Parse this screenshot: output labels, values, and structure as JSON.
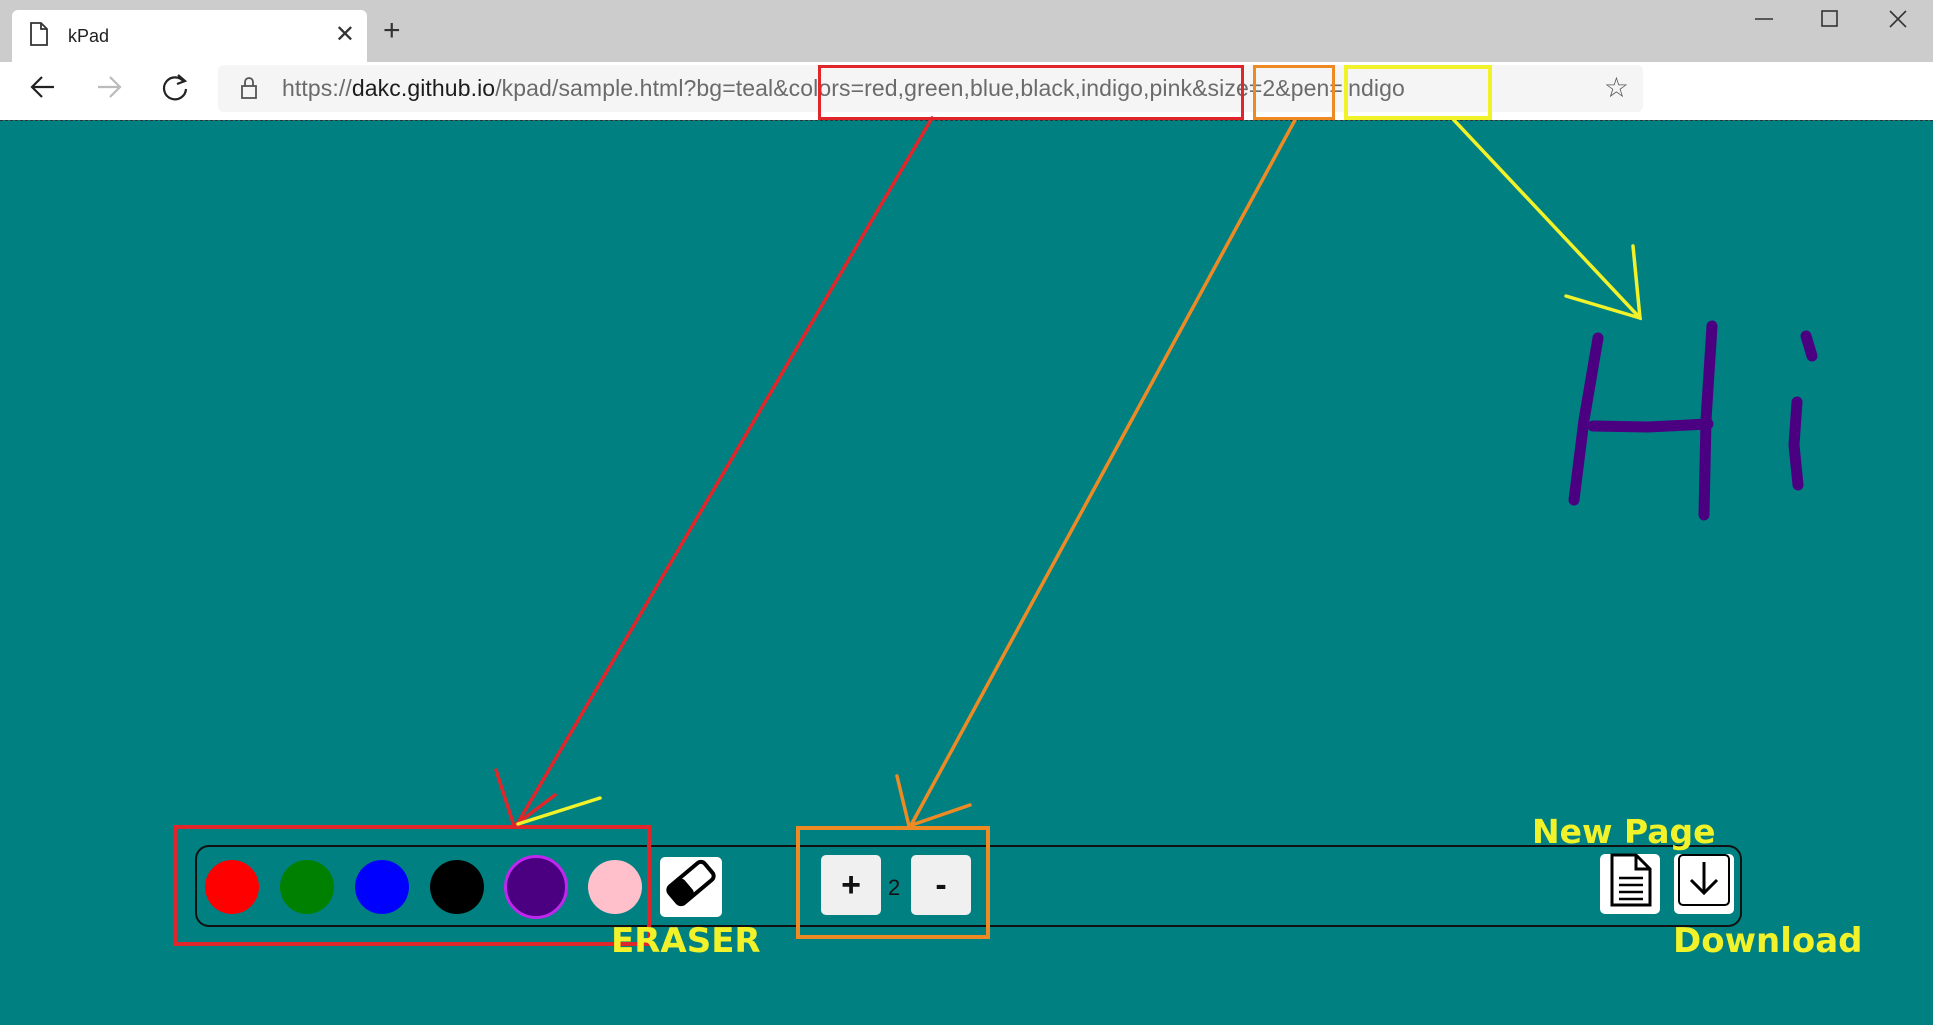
{
  "browser": {
    "tab_title": "kPad",
    "tab_close": "✕",
    "new_tab": "+",
    "url_prefix": "https://",
    "url_host": "dakc.github.io",
    "url_path": "/kpad/sample.html?bg=teal&colors=red,green,blue,black,indigo,pink&size=2&pen=indigo"
  },
  "page": {
    "background_color": "#008080"
  },
  "palette": {
    "colors": [
      {
        "name": "red",
        "hex": "#ff0000",
        "selected": false
      },
      {
        "name": "green",
        "hex": "#008000",
        "selected": false
      },
      {
        "name": "blue",
        "hex": "#0000ff",
        "selected": false
      },
      {
        "name": "black",
        "hex": "#000000",
        "selected": false
      },
      {
        "name": "indigo",
        "hex": "#4b0082",
        "selected": true
      },
      {
        "name": "pink",
        "hex": "#ffc0cb",
        "selected": false
      }
    ],
    "eraser_icon": "eraser-icon"
  },
  "size_controls": {
    "increase_label": "+",
    "value": "2",
    "decrease_label": "-"
  },
  "actions": {
    "new_page_icon": "document-icon",
    "download_icon": "download-icon"
  },
  "annotations": {
    "eraser_label": "ERASER",
    "new_page_label": "New Page",
    "download_label": "Download",
    "colors": {
      "red": "#e0262a",
      "orange": "#ee8a24",
      "yellow": "#f2f22a"
    }
  },
  "drawing": {
    "text": "Hi",
    "stroke_color": "#4b0082"
  }
}
